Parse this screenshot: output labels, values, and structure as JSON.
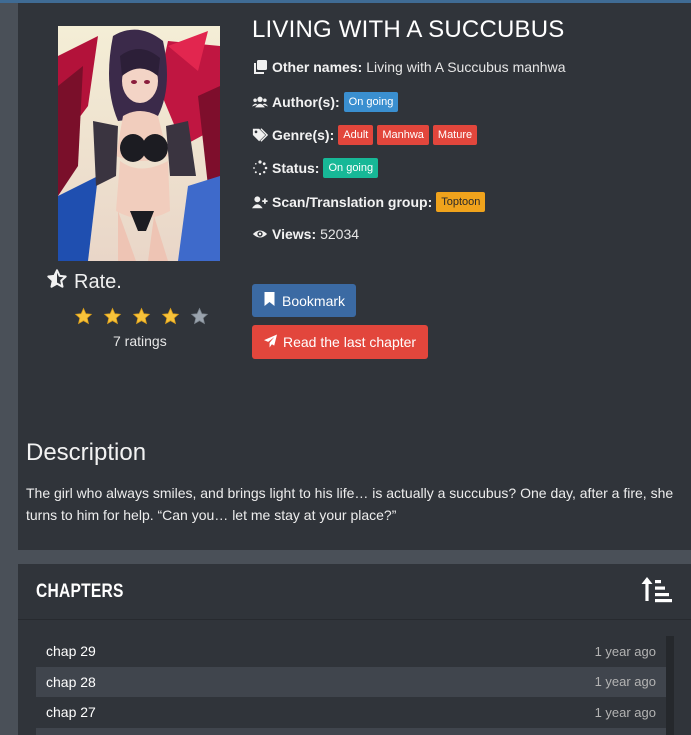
{
  "manga": {
    "title": "LIVING WITH A SUCCUBUS",
    "other_names_label": "Other names",
    "other_names": "Living with A Succubus manhwa",
    "authors_label": "Author(s)",
    "authors_badge": "On going",
    "genres_label": "Genre(s)",
    "genres": [
      "Adult",
      "Manhwa",
      "Mature"
    ],
    "status_label": "Status",
    "status": "On going",
    "group_label": "Scan/Translation group",
    "group": "Toptoon",
    "views_label": "Views",
    "views": "52034"
  },
  "rating": {
    "label": "Rate.",
    "stars_filled": 4,
    "stars_total": 5,
    "count_text": "7 ratings"
  },
  "actions": {
    "bookmark": "Bookmark",
    "read_last": "Read the last chapter"
  },
  "description": {
    "heading": "Description",
    "text": "The girl who always smiles, and brings light to his life… is actually a succubus? One day, after a fire, she turns to him for help. “Can you… let me stay at your place?”"
  },
  "chapters": {
    "heading": "CHAPTERS",
    "items": [
      {
        "name": "chap 29",
        "time": "1 year ago"
      },
      {
        "name": "chap 28",
        "time": "1 year ago"
      },
      {
        "name": "chap 27",
        "time": "1 year ago"
      },
      {
        "name": "",
        "time": ""
      }
    ]
  },
  "colors": {
    "accent_blue": "#3a8fd0",
    "badge_red": "#e2463c",
    "badge_green": "#17b897",
    "badge_yellow": "#f0a31c",
    "bookmark_button": "#3b6aa3",
    "read_button": "#e2463c",
    "star_gold": "#f7c33b",
    "star_gray": "#9aa3ad"
  },
  "icons": {
    "other_names": "copy-icon",
    "authors": "users-icon",
    "genres": "tags-icon",
    "status": "spinner-icon",
    "group": "user-plus-icon",
    "views": "eye-icon",
    "rate": "star-outline-icon",
    "bookmark": "bookmark-icon",
    "read": "paper-plane-icon",
    "sort": "sort-ascending-icon"
  }
}
